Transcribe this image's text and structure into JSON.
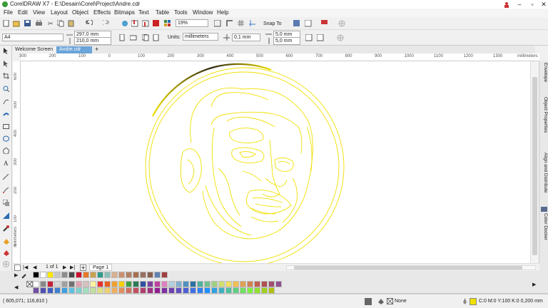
{
  "window": {
    "title": "CorelDRAW X7 - E:\\Desain\\Corel\\Project\\Andre.cdr"
  },
  "menu": [
    "File",
    "Edit",
    "View",
    "Layout",
    "Object",
    "Effects",
    "Bitmaps",
    "Text",
    "Table",
    "Tools",
    "Window",
    "Help"
  ],
  "toolbar": {
    "zoom": "19%",
    "snap_to": "Snap To"
  },
  "propertybar": {
    "page_size": "A4",
    "width": "297,0 mm",
    "height": "210,0 mm",
    "units_label": "Units:",
    "units_value": "millimeters",
    "nudge": "0,1 mm",
    "dup_x": "5,0 mm",
    "dup_y": "5,0 mm"
  },
  "tabs": [
    "Welcome Screen",
    "Andre.cdr"
  ],
  "ruler": {
    "h_ticks": [
      "300",
      "200",
      "100",
      "0",
      "100",
      "200",
      "300",
      "400",
      "500",
      "600",
      "700",
      "800",
      "900",
      "1000",
      "1100",
      "1200",
      "1300"
    ],
    "h_unit": "millimeters",
    "v_ticks": [
      "600",
      "500",
      "400",
      "300",
      "200",
      "100",
      "0",
      "100"
    ],
    "v_unit": "millimeters"
  },
  "pages": {
    "counter": "1 of 1",
    "page_tab": "Page 1"
  },
  "dockers": [
    "Envelope",
    "Object Properties",
    "Align and Distribute",
    "Color Docker"
  ],
  "status": {
    "coords": "( 605,071; 116,810 )",
    "fill_text": "None",
    "outline_text": "C:0 M:0 Y:100 K:0 0,200 mm"
  },
  "colors": {
    "outline": "#f0e000",
    "arc": "#2a2510",
    "palette_row1": [
      "#000000",
      "#ffffff",
      "#ffe900",
      "#c8c8c8",
      "#8c8c8c",
      "#4a4a4a",
      "#c8102e",
      "#e8782a",
      "#c8a050",
      "#2e9a8a",
      "#8ac0b8",
      "#d9b090",
      "#c89070",
      "#b08060",
      "#a87050",
      "#987060",
      "#886050",
      "#6080b0",
      "#a04040"
    ],
    "palette_row2": [
      "#ffffff",
      "#888888",
      "#c81e3a",
      "#d8d8d8",
      "#a0a0a0",
      "#707070",
      "#e0a0b0",
      "#d8c0c0",
      "#fff2a0",
      "#e83030",
      "#e86020",
      "#f0a030",
      "#f5d000",
      "#40a040",
      "#2a7a5a",
      "#3050a0",
      "#8040a0",
      "#c040a0",
      "#e080c0",
      "#b0d0e0",
      "#80b0d0",
      "#5090c0",
      "#3070a0",
      "#50b0a0",
      "#70c090",
      "#a0d080",
      "#d0e070",
      "#f0e060",
      "#f0c050",
      "#e0a050",
      "#d08050",
      "#c06050",
      "#b05050",
      "#a05070",
      "#905090",
      "#7050a0",
      "#5050b0",
      "#4060c0",
      "#4080d0",
      "#40a0e0",
      "#60c0e0",
      "#80d0d0",
      "#a0e0c0",
      "#c0e0a0",
      "#e0e080",
      "#f0d070",
      "#f0b060",
      "#e09060",
      "#d07060",
      "#c05060",
      "#b04070",
      "#a03080",
      "#902090",
      "#8030a0",
      "#7040b0",
      "#6050c0",
      "#5060d0",
      "#4070e0",
      "#3080f0",
      "#2090ff",
      "#30a0e0",
      "#40b0c0",
      "#50c0a0",
      "#60d080",
      "#70e060",
      "#80f040",
      "#90e030",
      "#a0d020",
      "#b0c010"
    ]
  }
}
